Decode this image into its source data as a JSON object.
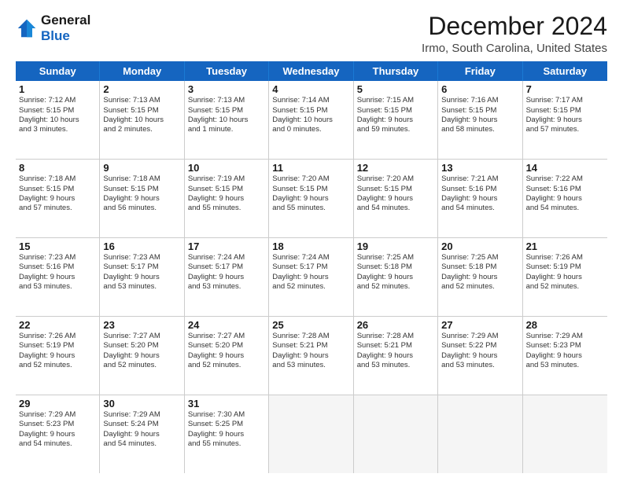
{
  "logo": {
    "line1": "General",
    "line2": "Blue"
  },
  "title": "December 2024",
  "subtitle": "Irmo, South Carolina, United States",
  "header_days": [
    "Sunday",
    "Monday",
    "Tuesday",
    "Wednesday",
    "Thursday",
    "Friday",
    "Saturday"
  ],
  "weeks": [
    [
      {
        "day": "1",
        "info": "Sunrise: 7:12 AM\nSunset: 5:15 PM\nDaylight: 10 hours\nand 3 minutes."
      },
      {
        "day": "2",
        "info": "Sunrise: 7:13 AM\nSunset: 5:15 PM\nDaylight: 10 hours\nand 2 minutes."
      },
      {
        "day": "3",
        "info": "Sunrise: 7:13 AM\nSunset: 5:15 PM\nDaylight: 10 hours\nand 1 minute."
      },
      {
        "day": "4",
        "info": "Sunrise: 7:14 AM\nSunset: 5:15 PM\nDaylight: 10 hours\nand 0 minutes."
      },
      {
        "day": "5",
        "info": "Sunrise: 7:15 AM\nSunset: 5:15 PM\nDaylight: 9 hours\nand 59 minutes."
      },
      {
        "day": "6",
        "info": "Sunrise: 7:16 AM\nSunset: 5:15 PM\nDaylight: 9 hours\nand 58 minutes."
      },
      {
        "day": "7",
        "info": "Sunrise: 7:17 AM\nSunset: 5:15 PM\nDaylight: 9 hours\nand 57 minutes."
      }
    ],
    [
      {
        "day": "8",
        "info": "Sunrise: 7:18 AM\nSunset: 5:15 PM\nDaylight: 9 hours\nand 57 minutes."
      },
      {
        "day": "9",
        "info": "Sunrise: 7:18 AM\nSunset: 5:15 PM\nDaylight: 9 hours\nand 56 minutes."
      },
      {
        "day": "10",
        "info": "Sunrise: 7:19 AM\nSunset: 5:15 PM\nDaylight: 9 hours\nand 55 minutes."
      },
      {
        "day": "11",
        "info": "Sunrise: 7:20 AM\nSunset: 5:15 PM\nDaylight: 9 hours\nand 55 minutes."
      },
      {
        "day": "12",
        "info": "Sunrise: 7:20 AM\nSunset: 5:15 PM\nDaylight: 9 hours\nand 54 minutes."
      },
      {
        "day": "13",
        "info": "Sunrise: 7:21 AM\nSunset: 5:16 PM\nDaylight: 9 hours\nand 54 minutes."
      },
      {
        "day": "14",
        "info": "Sunrise: 7:22 AM\nSunset: 5:16 PM\nDaylight: 9 hours\nand 54 minutes."
      }
    ],
    [
      {
        "day": "15",
        "info": "Sunrise: 7:23 AM\nSunset: 5:16 PM\nDaylight: 9 hours\nand 53 minutes."
      },
      {
        "day": "16",
        "info": "Sunrise: 7:23 AM\nSunset: 5:17 PM\nDaylight: 9 hours\nand 53 minutes."
      },
      {
        "day": "17",
        "info": "Sunrise: 7:24 AM\nSunset: 5:17 PM\nDaylight: 9 hours\nand 53 minutes."
      },
      {
        "day": "18",
        "info": "Sunrise: 7:24 AM\nSunset: 5:17 PM\nDaylight: 9 hours\nand 52 minutes."
      },
      {
        "day": "19",
        "info": "Sunrise: 7:25 AM\nSunset: 5:18 PM\nDaylight: 9 hours\nand 52 minutes."
      },
      {
        "day": "20",
        "info": "Sunrise: 7:25 AM\nSunset: 5:18 PM\nDaylight: 9 hours\nand 52 minutes."
      },
      {
        "day": "21",
        "info": "Sunrise: 7:26 AM\nSunset: 5:19 PM\nDaylight: 9 hours\nand 52 minutes."
      }
    ],
    [
      {
        "day": "22",
        "info": "Sunrise: 7:26 AM\nSunset: 5:19 PM\nDaylight: 9 hours\nand 52 minutes."
      },
      {
        "day": "23",
        "info": "Sunrise: 7:27 AM\nSunset: 5:20 PM\nDaylight: 9 hours\nand 52 minutes."
      },
      {
        "day": "24",
        "info": "Sunrise: 7:27 AM\nSunset: 5:20 PM\nDaylight: 9 hours\nand 52 minutes."
      },
      {
        "day": "25",
        "info": "Sunrise: 7:28 AM\nSunset: 5:21 PM\nDaylight: 9 hours\nand 53 minutes."
      },
      {
        "day": "26",
        "info": "Sunrise: 7:28 AM\nSunset: 5:21 PM\nDaylight: 9 hours\nand 53 minutes."
      },
      {
        "day": "27",
        "info": "Sunrise: 7:29 AM\nSunset: 5:22 PM\nDaylight: 9 hours\nand 53 minutes."
      },
      {
        "day": "28",
        "info": "Sunrise: 7:29 AM\nSunset: 5:23 PM\nDaylight: 9 hours\nand 53 minutes."
      }
    ],
    [
      {
        "day": "29",
        "info": "Sunrise: 7:29 AM\nSunset: 5:23 PM\nDaylight: 9 hours\nand 54 minutes."
      },
      {
        "day": "30",
        "info": "Sunrise: 7:29 AM\nSunset: 5:24 PM\nDaylight: 9 hours\nand 54 minutes."
      },
      {
        "day": "31",
        "info": "Sunrise: 7:30 AM\nSunset: 5:25 PM\nDaylight: 9 hours\nand 55 minutes."
      },
      {
        "day": "",
        "info": ""
      },
      {
        "day": "",
        "info": ""
      },
      {
        "day": "",
        "info": ""
      },
      {
        "day": "",
        "info": ""
      }
    ]
  ]
}
